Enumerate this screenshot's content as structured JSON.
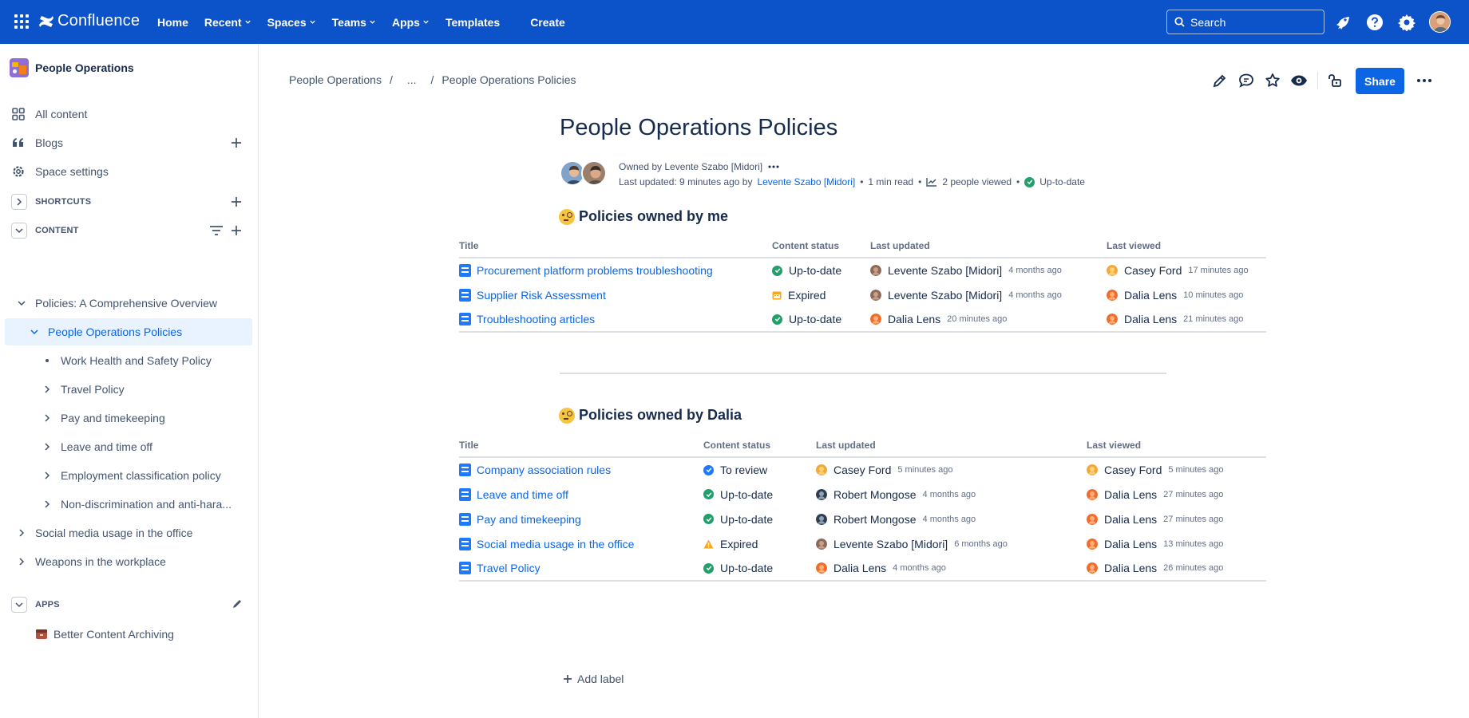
{
  "topnav": {
    "brand": "Confluence",
    "links": [
      {
        "label": "Home",
        "dropdown": false
      },
      {
        "label": "Recent",
        "dropdown": true
      },
      {
        "label": "Spaces",
        "dropdown": true
      },
      {
        "label": "Teams",
        "dropdown": true
      },
      {
        "label": "Apps",
        "dropdown": true
      },
      {
        "label": "Templates",
        "dropdown": false
      }
    ],
    "create_label": "Create",
    "search_placeholder": "Search",
    "bar_color": "#0c52c8"
  },
  "sidebar": {
    "space_name": "People Operations",
    "items": [
      {
        "label": "All content",
        "icon": "grid-icon"
      },
      {
        "label": "Blogs",
        "icon": "quote-icon"
      },
      {
        "label": "Space settings",
        "icon": "gear-icon"
      }
    ],
    "shortcuts_label": "SHORTCUTS",
    "content_label": "CONTENT",
    "tree": [
      {
        "label": "Policies: A Comprehensive Overview",
        "level": 0,
        "state": "expanded"
      },
      {
        "label": "People Operations Policies",
        "level": 1,
        "state": "expanded",
        "selected": true
      },
      {
        "label": "Work Health and Safety Policy",
        "level": 2,
        "state": "leaf"
      },
      {
        "label": "Travel Policy",
        "level": 2,
        "state": "collapsed"
      },
      {
        "label": "Pay and timekeeping",
        "level": 2,
        "state": "collapsed"
      },
      {
        "label": "Leave and time off",
        "level": 2,
        "state": "collapsed"
      },
      {
        "label": "Employment classification policy",
        "level": 2,
        "state": "collapsed"
      },
      {
        "label": "Non-discrimination and anti-hara...",
        "level": 2,
        "state": "collapsed"
      },
      {
        "label": "Social media usage in the office",
        "level": 0,
        "state": "collapsed"
      },
      {
        "label": "Weapons in the workplace",
        "level": 0,
        "state": "collapsed"
      }
    ],
    "apps_label": "APPS",
    "apps": [
      {
        "label": "Better Content Archiving"
      }
    ]
  },
  "breadcrumb": {
    "root": "People Operations",
    "ellipsis": "...",
    "current": "People Operations Policies"
  },
  "toolbar": {
    "share_label": "Share"
  },
  "page": {
    "title": "People Operations Policies",
    "owned_by": "Owned by Levente Szabo [Midori]",
    "last_updated_prefix": "Last updated: 9 minutes ago by",
    "last_updated_author": "Levente Szabo [Midori]",
    "read_time": "1 min read",
    "views": "2 people viewed",
    "status": "Up-to-date"
  },
  "section1": {
    "title": "Policies owned by me",
    "headers": [
      "Title",
      "Content status",
      "Last updated",
      "Last viewed"
    ],
    "rows": [
      {
        "title": "Procurement platform problems troubleshooting",
        "status": "Up-to-date",
        "status_kind": "ok",
        "updated_by": "Levente Szabo [Midori]",
        "updated_ago": "4 months ago",
        "viewed_by": "Casey Ford",
        "viewed_ago": "17 minutes ago",
        "u_av": "levente",
        "v_av": "casey"
      },
      {
        "title": "Supplier Risk Assessment",
        "status": "Expired",
        "status_kind": "expired-cal",
        "updated_by": "Levente Szabo [Midori]",
        "updated_ago": "4 months ago",
        "viewed_by": "Dalia Lens",
        "viewed_ago": "10 minutes ago",
        "u_av": "levente",
        "v_av": "dalia"
      },
      {
        "title": "Troubleshooting articles",
        "status": "Up-to-date",
        "status_kind": "ok",
        "updated_by": "Dalia Lens",
        "updated_ago": "20 minutes ago",
        "viewed_by": "Dalia Lens",
        "viewed_ago": "21 minutes ago",
        "u_av": "dalia",
        "v_av": "dalia"
      }
    ]
  },
  "section2": {
    "title": "Policies owned by Dalia",
    "headers": [
      "Title",
      "Content status",
      "Last updated",
      "Last viewed"
    ],
    "rows": [
      {
        "title": "Company association rules",
        "status": "To review",
        "status_kind": "review",
        "updated_by": "Casey Ford",
        "updated_ago": "5 minutes ago",
        "viewed_by": "Casey Ford",
        "viewed_ago": "5 minutes ago",
        "u_av": "casey",
        "v_av": "casey"
      },
      {
        "title": "Leave and time off",
        "status": "Up-to-date",
        "status_kind": "ok",
        "updated_by": "Robert Mongose",
        "updated_ago": "4 months ago",
        "viewed_by": "Dalia Lens",
        "viewed_ago": "27 minutes ago",
        "u_av": "robert",
        "v_av": "dalia"
      },
      {
        "title": "Pay and timekeeping",
        "status": "Up-to-date",
        "status_kind": "ok",
        "updated_by": "Robert Mongose",
        "updated_ago": "4 months ago",
        "viewed_by": "Dalia Lens",
        "viewed_ago": "27 minutes ago",
        "u_av": "robert",
        "v_av": "dalia"
      },
      {
        "title": "Social media usage in the office",
        "status": "Expired",
        "status_kind": "expired-warn",
        "updated_by": "Levente Szabo [Midori]",
        "updated_ago": "6 months ago",
        "viewed_by": "Dalia Lens",
        "viewed_ago": "13 minutes ago",
        "u_av": "levente",
        "v_av": "dalia"
      },
      {
        "title": "Travel Policy",
        "status": "Up-to-date",
        "status_kind": "ok",
        "updated_by": "Dalia Lens",
        "updated_ago": "4 months ago",
        "viewed_by": "Dalia Lens",
        "viewed_ago": "26 minutes ago",
        "u_av": "dalia",
        "v_av": "dalia"
      }
    ]
  },
  "footer": {
    "add_label": "Add label"
  },
  "colors": {
    "link": "#0c66e4",
    "ok": "#22a06b",
    "review": "#1d7afc",
    "expired": "#f5a623",
    "selected_bg": "#e9f2ff"
  }
}
